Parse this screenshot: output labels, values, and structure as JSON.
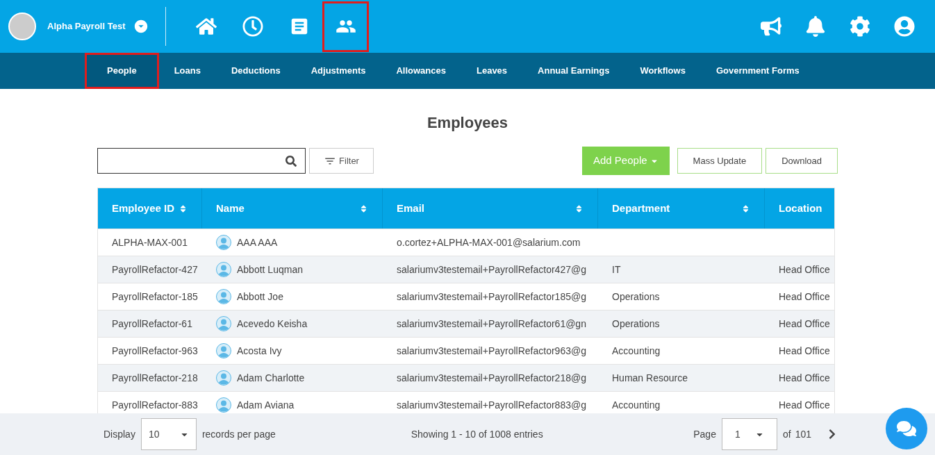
{
  "account": {
    "name": "Alpha Payroll Test"
  },
  "top_nav": [
    {
      "kind": "home",
      "highlighted": false
    },
    {
      "kind": "clock",
      "highlighted": false
    },
    {
      "kind": "document",
      "highlighted": false
    },
    {
      "kind": "people",
      "highlighted": true
    }
  ],
  "top_actions": [
    {
      "kind": "megaphone"
    },
    {
      "kind": "bell"
    },
    {
      "kind": "settings"
    },
    {
      "kind": "profile"
    }
  ],
  "sub_nav": [
    {
      "label": "People",
      "selected": true,
      "highlighted": true
    },
    {
      "label": "Loans",
      "selected": false,
      "highlighted": false
    },
    {
      "label": "Deductions",
      "selected": false,
      "highlighted": false
    },
    {
      "label": "Adjustments",
      "selected": false,
      "highlighted": false
    },
    {
      "label": "Allowances",
      "selected": false,
      "highlighted": false
    },
    {
      "label": "Leaves",
      "selected": false,
      "highlighted": false
    },
    {
      "label": "Annual Earnings",
      "selected": false,
      "highlighted": false
    },
    {
      "label": "Workflows",
      "selected": false,
      "highlighted": false
    },
    {
      "label": "Government Forms",
      "selected": false,
      "highlighted": false
    }
  ],
  "page_title": "Employees",
  "filter_button": "Filter",
  "buttons": [
    {
      "kind": "primary",
      "label": "Add People"
    },
    {
      "kind": "outline",
      "label": "Mass Update"
    },
    {
      "kind": "outline",
      "label": "Download"
    }
  ],
  "table": {
    "columns": [
      {
        "label": "Employee ID",
        "sortable": true
      },
      {
        "label": "Name",
        "sortable": true
      },
      {
        "label": "Email",
        "sortable": true
      },
      {
        "label": "Department",
        "sortable": true
      },
      {
        "label": "Location"
      }
    ],
    "rows": [
      [
        "ALPHA-MAX-001",
        "AAA AAA",
        "o.cortez+ALPHA-MAX-001@salarium.com",
        "",
        ""
      ],
      [
        "PayrollRefactor-427",
        "Abbott Luqman",
        "salariumv3testemail+PayrollRefactor427@g",
        "IT",
        "Head Office"
      ],
      [
        "PayrollRefactor-185",
        "Abbott Joe",
        "salariumv3testemail+PayrollRefactor185@g",
        "Operations",
        "Head Office"
      ],
      [
        "PayrollRefactor-61",
        "Acevedo Keisha",
        "salariumv3testemail+PayrollRefactor61@gn",
        "Operations",
        "Head Office"
      ],
      [
        "PayrollRefactor-963",
        "Acosta Ivy",
        "salariumv3testemail+PayrollRefactor963@g",
        "Accounting",
        "Head Office"
      ],
      [
        "PayrollRefactor-218",
        "Adam Charlotte",
        "salariumv3testemail+PayrollRefactor218@g",
        "Human Resource",
        "Head Office"
      ],
      [
        "PayrollRefactor-883",
        "Adam Aviana",
        "salariumv3testemail+PayrollRefactor883@g",
        "Accounting",
        "Head Office"
      ]
    ]
  },
  "footer": {
    "display_label": "Display",
    "per_page": "10",
    "per_page_label": "records per page",
    "showing": "Showing 1 - 10 of 1008 entries",
    "page_label": "Page",
    "page": "1",
    "of_label": "of",
    "total_pages": "101"
  }
}
